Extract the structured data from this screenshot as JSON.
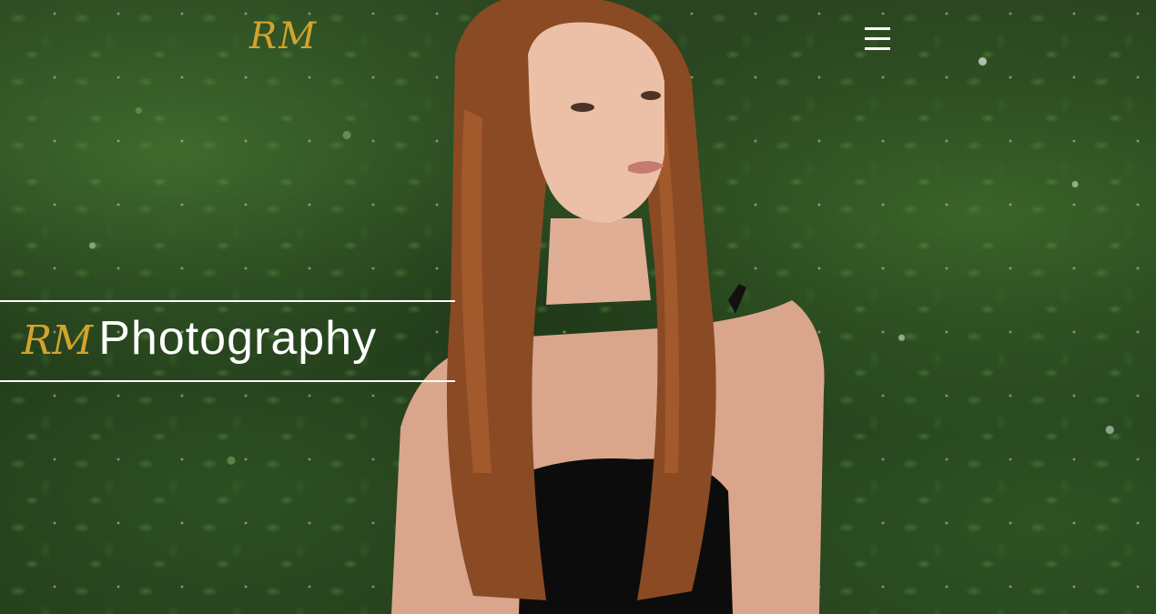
{
  "header": {
    "logo_text": "RM",
    "menu_icon": "hamburger-menu-icon"
  },
  "hero": {
    "title_mark": "RM",
    "title_word": "Photography"
  },
  "colors": {
    "brand_gold": "#d4a32b",
    "text_white": "#ffffff"
  }
}
